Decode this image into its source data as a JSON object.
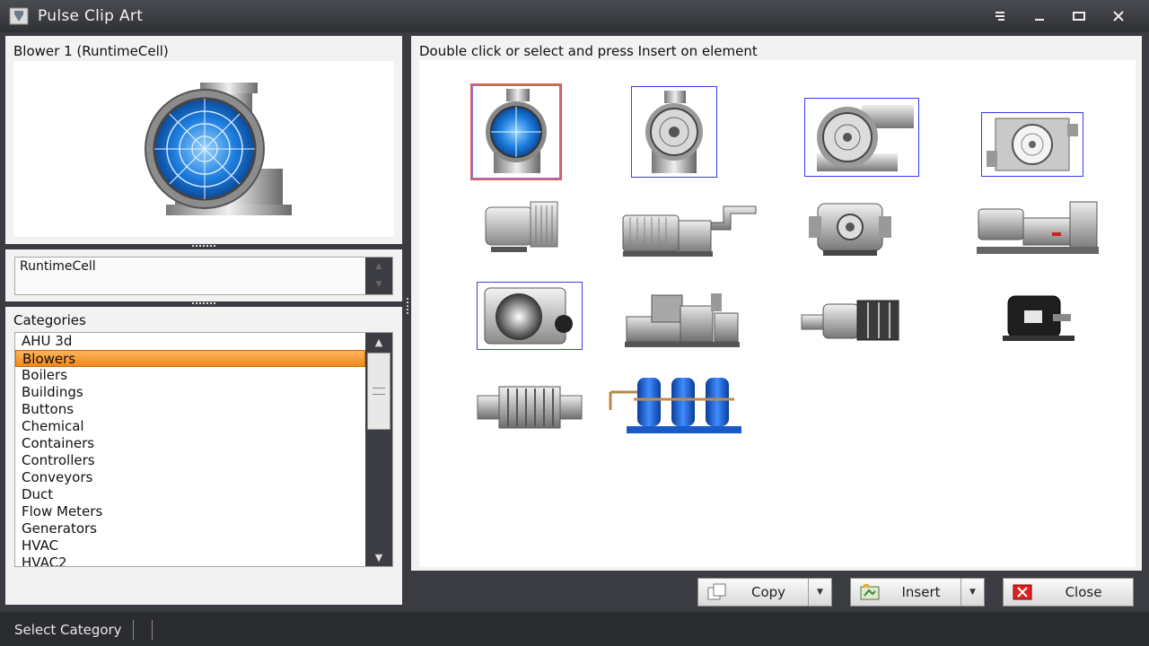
{
  "window": {
    "title": "Pulse Clip Art",
    "controls": [
      "menu-icon",
      "minimize-icon",
      "maximize-icon",
      "close-icon"
    ]
  },
  "left_pane": {
    "title": "Blower 1 (RuntimeCell)",
    "cell_type": "RuntimeCell",
    "categories_label": "Categories",
    "categories": [
      "AHU 3d",
      "Blowers",
      "Boilers",
      "Buildings",
      "Buttons",
      "Chemical",
      "Containers",
      "Controllers",
      "Conveyors",
      "Duct",
      "Flow Meters",
      "Generators",
      "HVAC",
      "HVAC2"
    ],
    "selected_category": "Blowers"
  },
  "right_pane": {
    "instruction": "Double click or select and press Insert on element"
  },
  "buttons": {
    "copy": "Copy",
    "insert": "Insert",
    "close": "Close"
  },
  "status": {
    "text": "Select Category"
  },
  "colors": {
    "selection": "#f39a30",
    "frame": "#3a3aee",
    "selected_frame": "#e45a5a",
    "blower_blue": "#1f7fe0"
  }
}
